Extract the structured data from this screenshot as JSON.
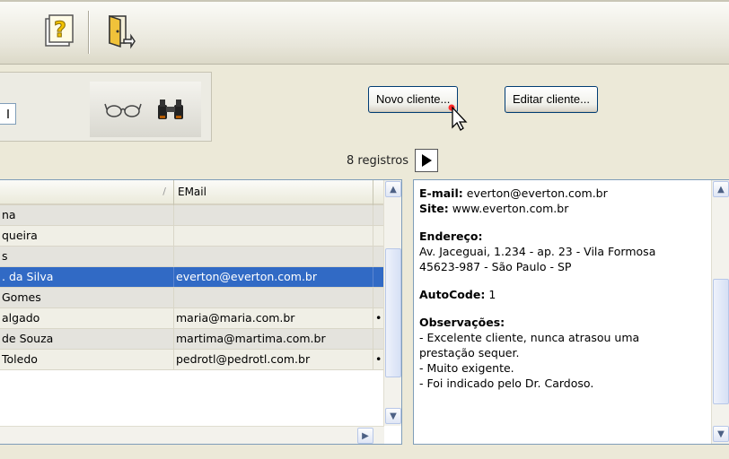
{
  "toolbar": {
    "help_button": "help-icon",
    "exit_button": "exit-door-icon"
  },
  "filter": {
    "tools": [
      "glasses-icon",
      "binoculars-icon"
    ],
    "new_client_label": "Novo cliente...",
    "edit_client_label": "Editar cliente..."
  },
  "records": {
    "count_text": "8 registros",
    "next_icon": "play-icon"
  },
  "grid": {
    "columns": [
      "",
      "EMail",
      ""
    ],
    "rows": [
      {
        "name": "na",
        "email": "",
        "extra": ""
      },
      {
        "name": "queira",
        "email": "",
        "extra": ""
      },
      {
        "name": "s",
        "email": "",
        "extra": ""
      },
      {
        "name": ". da Silva",
        "email": "everton@everton.com.br",
        "extra": "",
        "selected": true
      },
      {
        "name": " Gomes",
        "email": "",
        "extra": ""
      },
      {
        "name": "algado",
        "email": "maria@maria.com.br",
        "extra": "•"
      },
      {
        "name": " de Souza",
        "email": "martima@martima.com.br",
        "extra": ""
      },
      {
        "name": "Toledo",
        "email": "pedrotl@pedrotl.com.br",
        "extra": "•"
      }
    ]
  },
  "detail": {
    "email_label": "E-mail:",
    "email_value": "everton@everton.com.br",
    "site_label": "Site:",
    "site_value": "www.everton.com.br",
    "address_label": "Endereço:",
    "address_line1": "Av. Jaceguai, 1.234 - ap. 23 - Vila Formosa",
    "address_line2": "45623-987 - São Paulo - SP",
    "autocode_label": "AutoCode:",
    "autocode_value": "1",
    "notes_label": "Observações:",
    "notes": [
      "- Excelente cliente, nunca atrasou uma",
      "prestação sequer.",
      "- Muito exigente.",
      "- Foi indicado pelo Dr. Cardoso."
    ]
  },
  "colors": {
    "selection": "#316ac5",
    "window_bg": "#ece9d8",
    "border": "#7f9db9"
  }
}
